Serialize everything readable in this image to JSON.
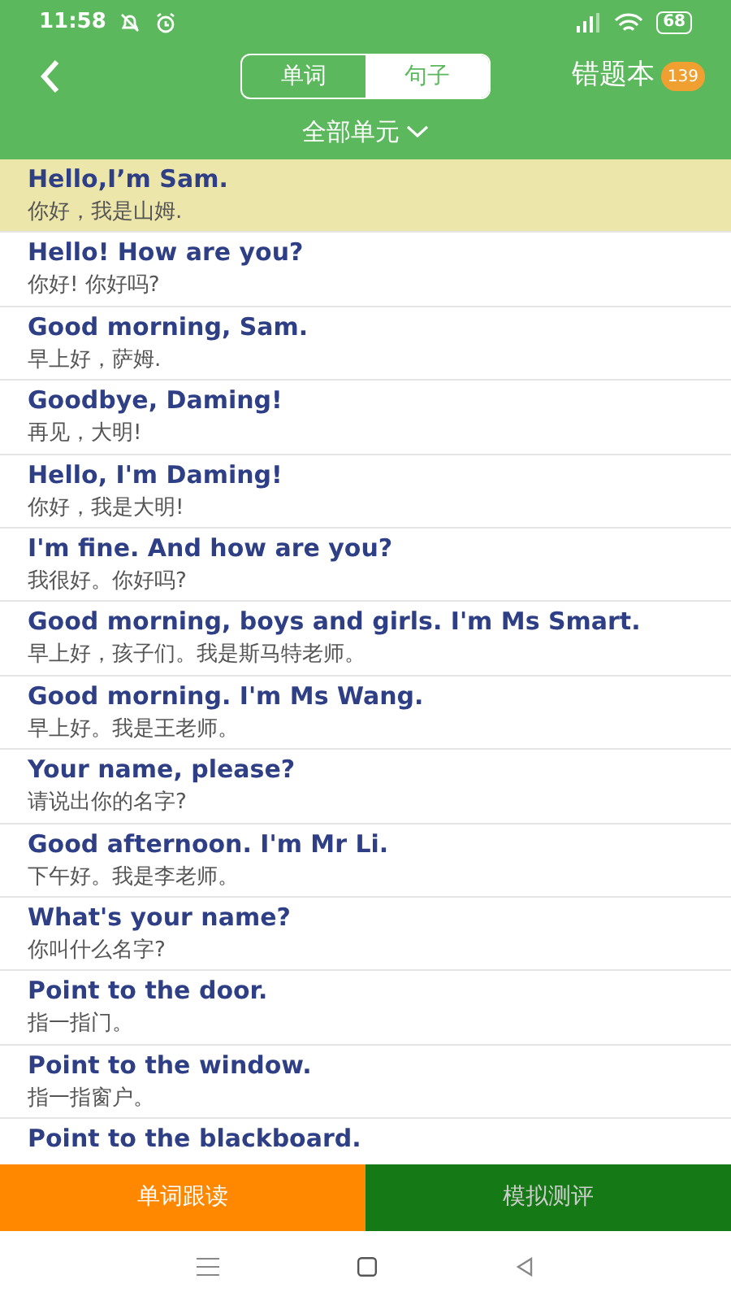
{
  "status_bar": {
    "time": "11:58",
    "battery": "68"
  },
  "header": {
    "tabs": [
      {
        "label": "单词",
        "selected": false
      },
      {
        "label": "句子",
        "selected": true
      }
    ],
    "mistakes": {
      "label": "错题本",
      "count": "139"
    }
  },
  "unit_filter": {
    "label": "全部单元"
  },
  "sentences": [
    {
      "english": "Hello,I’m Sam.",
      "chinese": "你好，我是山姆.",
      "selected": true
    },
    {
      "english": "Hello! How are you?",
      "chinese": "你好! 你好吗?",
      "selected": false
    },
    {
      "english": "Good morning, Sam.",
      "chinese": "早上好，萨姆.",
      "selected": false
    },
    {
      "english": "Goodbye, Daming!",
      "chinese": "再见，大明!",
      "selected": false
    },
    {
      "english": "Hello, I'm Daming!",
      "chinese": "你好，我是大明!",
      "selected": false
    },
    {
      "english": "I'm fine. And how are you?",
      "chinese": "我很好。你好吗?",
      "selected": false
    },
    {
      "english": "Good morning, boys and girls. I'm Ms Smart.",
      "chinese": "早上好，孩子们。我是斯马特老师。",
      "selected": false
    },
    {
      "english": "Good morning. I'm Ms Wang.",
      "chinese": "早上好。我是王老师。",
      "selected": false
    },
    {
      "english": "Your name, please?",
      "chinese": "请说出你的名字?",
      "selected": false
    },
    {
      "english": "Good afternoon. I'm Mr Li.",
      "chinese": "下午好。我是李老师。",
      "selected": false
    },
    {
      "english": "What's your name?",
      "chinese": "你叫什么名字?",
      "selected": false
    },
    {
      "english": "Point to the door.",
      "chinese": "指一指门。",
      "selected": false
    },
    {
      "english": "Point to the window.",
      "chinese": "指一指窗户。",
      "selected": false
    },
    {
      "english": "Point to the blackboard.",
      "selected": false
    }
  ],
  "bottom_buttons": [
    {
      "label": "单词跟读",
      "kind": "orange"
    },
    {
      "label": "模拟测评",
      "kind": "green"
    }
  ]
}
